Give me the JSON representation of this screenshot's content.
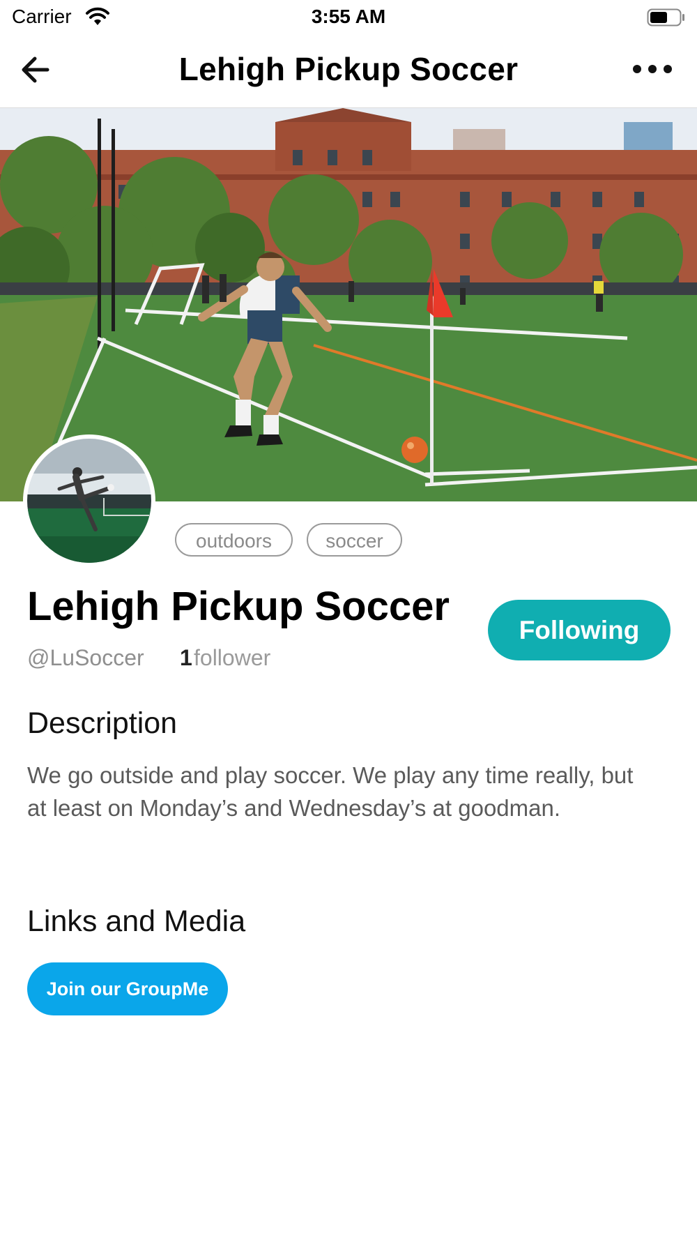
{
  "status_bar": {
    "carrier": "Carrier",
    "time": "3:55 AM",
    "wifi_icon": "wifi-icon",
    "battery_icon": "battery-icon"
  },
  "nav": {
    "title": "Lehigh Pickup Soccer",
    "back_icon": "arrow-left-icon",
    "more_icon": "ellipsis-icon"
  },
  "cover": {
    "image": "soccer-field-cover-photo"
  },
  "avatar": {
    "image": "soccer-player-kicking-avatar"
  },
  "tags": [
    "outdoors",
    "soccer"
  ],
  "group": {
    "name": "Lehigh Pickup Soccer",
    "handle": "@LuSoccer",
    "follower_count": "1",
    "follower_label": "follower",
    "follow_button_label": "Following"
  },
  "description": {
    "heading": "Description",
    "text": "We go outside and play soccer.  We play any time really, but at least on Monday’s and Wednesday’s at goodman."
  },
  "links": {
    "heading": "Links and Media",
    "items": [
      "Join our GroupMe"
    ]
  },
  "colors": {
    "follow_button": "#10aeb1",
    "link_button": "#0aa6ea",
    "muted_text": "#8f8f8f"
  }
}
